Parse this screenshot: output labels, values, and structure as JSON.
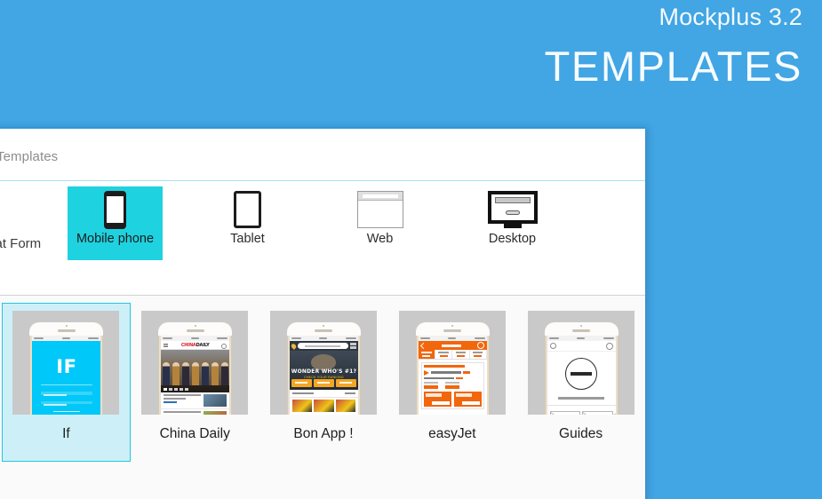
{
  "promo": {
    "version": "Mockplus 3.2",
    "title": "TEMPLATES"
  },
  "window": {
    "title": "Templates"
  },
  "platform": {
    "label": "Flat Form",
    "items": [
      {
        "name": "Mobile phone",
        "icon": "mobile-phone-icon",
        "selected": true
      },
      {
        "name": "Tablet",
        "icon": "tablet-icon",
        "selected": false
      },
      {
        "name": "Web",
        "icon": "web-browser-icon",
        "selected": false
      },
      {
        "name": "Desktop",
        "icon": "desktop-monitor-icon",
        "selected": false
      }
    ]
  },
  "templates": {
    "items": [
      {
        "name": "If",
        "selected": true
      },
      {
        "name": "China Daily",
        "selected": false
      },
      {
        "name": "Bon App !",
        "selected": false
      },
      {
        "name": "easyJet",
        "selected": false
      },
      {
        "name": "Guides",
        "selected": false
      }
    ]
  },
  "thumbnails": {
    "if": {
      "logo": "IF"
    },
    "china_daily": {
      "logo_left": "CHINA",
      "logo_right": "DAILY"
    },
    "bon_app": {
      "headline": "WONDER WHO'S #1?",
      "subline": "CHECK YOUR RANKING"
    }
  },
  "colors": {
    "brand_blue": "#42a5e4",
    "accent_cyan": "#1fd2e0",
    "selection_bg": "#cdf0f8",
    "selection_border": "#22c6de",
    "if_screen": "#00c8f8",
    "easyjet_orange": "#f2660c",
    "thumb_backdrop": "#c9c9c9"
  }
}
